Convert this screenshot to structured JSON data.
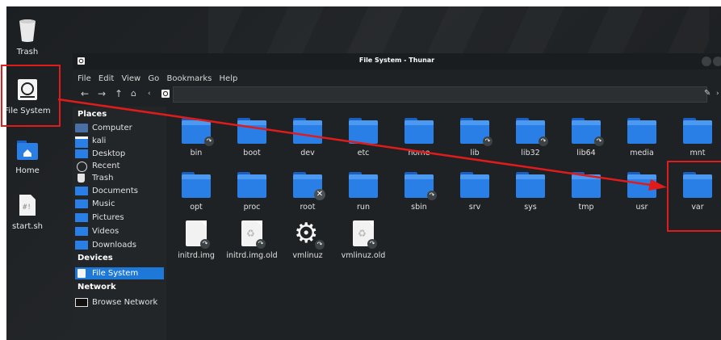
{
  "desktop": {
    "icons": [
      {
        "label": "Trash",
        "icon": "trash-icon"
      },
      {
        "label": "File System",
        "icon": "hard-drive-icon"
      },
      {
        "label": "Home",
        "icon": "home-folder-icon"
      },
      {
        "label": "start.sh",
        "icon": "script-file-icon"
      }
    ]
  },
  "window": {
    "title": "File System - Thunar",
    "menu": [
      "File",
      "Edit",
      "View",
      "Go",
      "Bookmarks",
      "Help"
    ]
  },
  "sidebar": {
    "places_title": "Places",
    "places": [
      "Computer",
      "kali",
      "Desktop",
      "Recent",
      "Trash",
      "Documents",
      "Music",
      "Pictures",
      "Videos",
      "Downloads"
    ],
    "devices_title": "Devices",
    "devices": [
      "File System"
    ],
    "network_title": "Network",
    "network": [
      "Browse Network"
    ]
  },
  "content": {
    "row1": [
      "bin",
      "boot",
      "dev",
      "etc",
      "home",
      "lib",
      "lib32",
      "lib64",
      "media",
      "mnt"
    ],
    "row2": [
      "opt",
      "proc",
      "root",
      "run",
      "sbin",
      "srv",
      "sys",
      "tmp",
      "usr",
      "var"
    ],
    "row3": [
      "initrd.img",
      "initrd.img.old",
      "vmlinuz",
      "vmlinuz.old"
    ]
  },
  "colors": {
    "folder": "#2a7fe6",
    "selection": "#1e78d8",
    "highlight": "#e01b1b"
  }
}
